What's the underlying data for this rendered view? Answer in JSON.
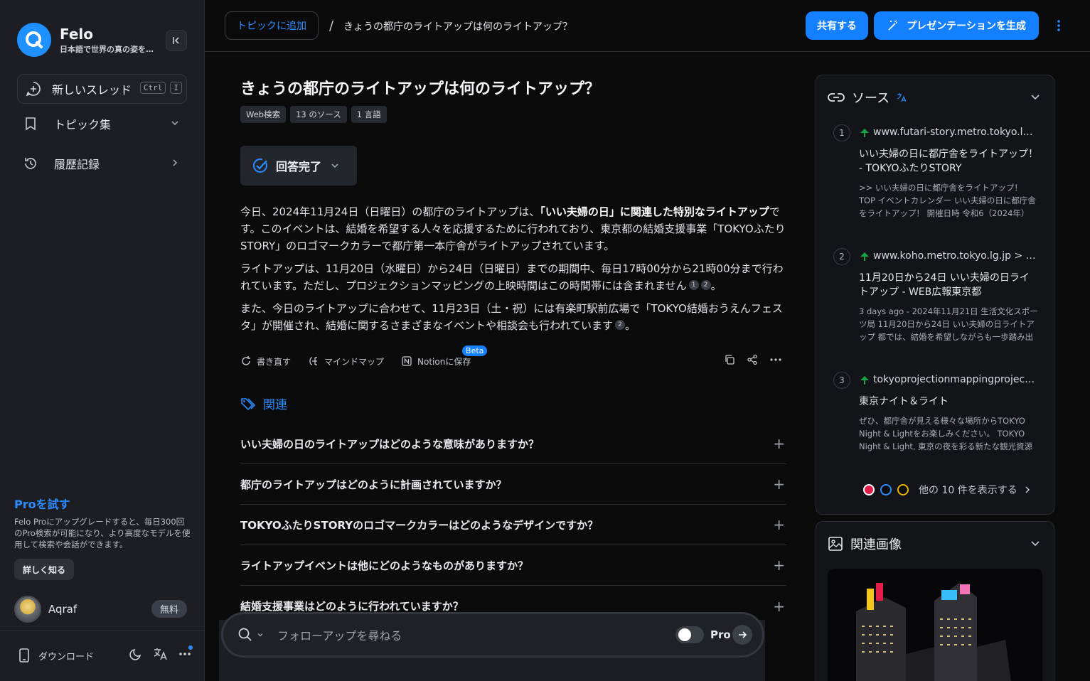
{
  "sidebar": {
    "brand_name": "Felo",
    "brand_tagline": "日本語で世界の真の姿を発見",
    "new_thread_label": "新しいスレッド",
    "shortcut_keys": [
      "Ctrl",
      "I"
    ],
    "nav_items": [
      {
        "label": "トピック集",
        "icon": "bookmark-icon",
        "chevron": "down"
      },
      {
        "label": "履歴記録",
        "icon": "history-icon",
        "chevron": "right"
      }
    ],
    "pro_title": "Proを試す",
    "pro_desc": "Felo Proにアップグレードすると、毎日300回のPro検索が可能になり、より高度なモデルを使用して検索や会話ができます。",
    "learn_more_label": "詳しく知る",
    "user_name": "Aqraf",
    "plan_label": "無料",
    "download_label": "ダウンロード"
  },
  "header": {
    "add_topic_label": "トピックに追加",
    "breadcrumb_sep": "/",
    "breadcrumb_title": "きょうの都庁のライトアップは何のライトアップ？",
    "share_label": "共有する",
    "presentation_label": "プレゼンテーションを生成"
  },
  "main": {
    "question": "きょうの都庁のライトアップは何のライトアップ？",
    "tags": [
      "Web検索",
      "13 のソース",
      "1 言語"
    ],
    "status_label": "回答完了",
    "answer": {
      "p1_a": "今日、2024年11月24日（日曜日）の都庁のライトアップは、",
      "p1_bold": "「いい夫婦の日」に関連した特別なライトアップ",
      "p1_b": "です。このイベントは、結婚を希望する人々を応援するために行われており、東京都の結婚支援事業「TOKYOふたりSTORY」のロゴマークカラーで都庁第一本庁舎がライトアップされています。",
      "p2": "ライトアップは、11月20日（水曜日）から24日（日曜日）までの期間中、毎日17時00分から21時00分まで行われています。ただし、プロジェクションマッピングの上映時間はこの時間帯には含まれません",
      "p2_cites": [
        "1",
        "2"
      ],
      "p2_end": "。",
      "p3": "また、今日のライトアップに合わせて、11月23日（土・祝）には有楽町駅前広場で「TOKYO結婚おうえんフェスタ」が開催され、結婚に関するさまざまなイベントや相談会も行われています",
      "p3_cites": [
        "2"
      ],
      "p3_end": "。"
    },
    "actions": {
      "rewrite": "書き直す",
      "mindmap": "マインドマップ",
      "notion": "Notionに保存",
      "beta": "Beta"
    },
    "related_heading": "関連",
    "related": [
      "いい夫婦の日のライトアップはどのような意味がありますか？",
      "都庁のライトアップはどのように計画されていますか？",
      "TOKYOふたりSTORYのロゴマークカラーはどのようなデザインですか？",
      "ライトアップイベントは他にどのようなものがありますか？",
      "結婚支援事業はどのように行われていますか？"
    ],
    "followup_placeholder": "フォローアップを尋ねる",
    "pro_toggle_label": "Pro"
  },
  "sources": {
    "heading": "ソース",
    "items": [
      {
        "num": "1",
        "url": "www.futari-story.metro.tokyo.lg.jp",
        "title": "いい夫婦の日に都庁舎をライトアップ！ - TOKYOふたりSTORY",
        "snippet": ">> いい夫婦の日に都庁舎をライトアップ！ TOP イベントカレンダー いい夫婦の日に都庁舎をライトアップ！ 開催日時 令和6（2024年）"
      },
      {
        "num": "2",
        "url": "www.koho.metro.tokyo.lg.jp > diary",
        "title": "11月20日から24日 いい夫婦の日ライトアップ - WEB広報東京都",
        "snippet": "3 days ago - 2024年11月21日 生活文化スポーツ局 11月20日から24日 いい夫婦の日ライトアップ 都では、結婚を希望しながらも一歩踏み出せない"
      },
      {
        "num": "3",
        "url": "tokyoprojectionmappingproject.jp",
        "title": "東京ナイト＆ライト",
        "snippet": "ぜひ、都庁舎が見える様々な場所からTOKYO Night & Lightをお楽しみください。 TOKYO Night & Light, 東京の夜を彩る新たな観光資源"
      }
    ],
    "more_label": "他の 10 件を表示する"
  },
  "images": {
    "heading": "関連画像"
  },
  "colors": {
    "accent": "#1580ff",
    "sidebar_bg": "#1c1e23",
    "page_bg": "#0b0b0c"
  }
}
